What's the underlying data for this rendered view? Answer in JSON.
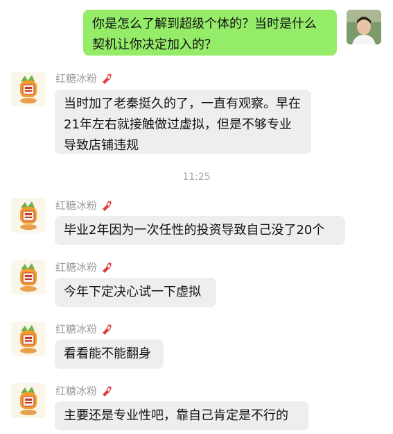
{
  "messages": [
    {
      "from": "me",
      "text": "你是怎么了解到超级个体的？当时是什么契机让你决定加入的？"
    },
    {
      "from": "them",
      "sender": "红糖冰粉",
      "text": "当时加了老秦挺久的了，一直有观察。早在21年左右就接触做过虚拟，但是不够专业导致店铺违规"
    },
    {
      "from": "them",
      "sender": "红糖冰粉",
      "text": "毕业2年因为一次任性的投资导致自己没了20个"
    },
    {
      "from": "them",
      "sender": "红糖冰粉",
      "text": "今年下定决心试一下虚拟"
    },
    {
      "from": "them",
      "sender": "红糖冰粉",
      "text": "看看能不能翻身"
    },
    {
      "from": "them",
      "sender": "红糖冰粉",
      "text": "主要还是专业性吧，靠自己肯定是不行的"
    }
  ],
  "timestamp": "11:25",
  "colors": {
    "my_bubble": "#95ec69",
    "their_bubble": "#eeeef0",
    "sender_name": "#9a9a9a"
  },
  "icons": {
    "sender_tag": "red-lobster-icon",
    "their_avatar": "carrot-cartoon-avatar",
    "my_avatar": "user-photo-avatar"
  }
}
